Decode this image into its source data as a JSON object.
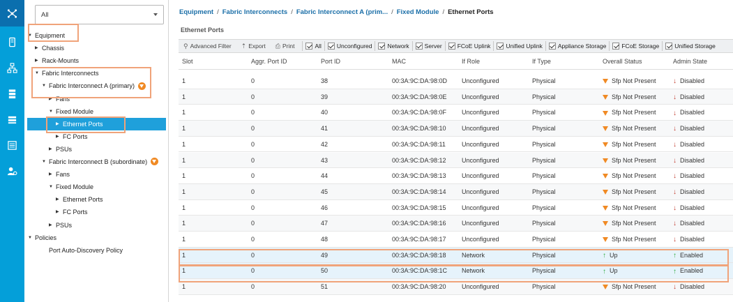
{
  "nav": {
    "filter": {
      "value": "All"
    },
    "items": [
      {
        "label": "Equipment",
        "level": 0,
        "arrow": "▼",
        "selected": false
      },
      {
        "label": "Chassis",
        "level": 1,
        "arrow": "▶",
        "selected": false
      },
      {
        "label": "Rack-Mounts",
        "level": 1,
        "arrow": "▶",
        "selected": false
      },
      {
        "label": "Fabric Interconnects",
        "level": 1,
        "arrow": "▼",
        "selected": false
      },
      {
        "label": "Fabric Interconnect A (primary)",
        "level": 2,
        "arrow": "▼",
        "selected": false,
        "warn": true
      },
      {
        "label": "Fans",
        "level": 3,
        "arrow": "▶",
        "selected": false
      },
      {
        "label": "Fixed Module",
        "level": 3,
        "arrow": "▼",
        "selected": false
      },
      {
        "label": "Ethernet Ports",
        "level": 4,
        "arrow": "▶",
        "selected": true
      },
      {
        "label": "FC Ports",
        "level": 4,
        "arrow": "▶",
        "selected": false
      },
      {
        "label": "PSUs",
        "level": 3,
        "arrow": "▶",
        "selected": false
      },
      {
        "label": "Fabric Interconnect B (subordinate)",
        "level": 2,
        "arrow": "▼",
        "selected": false,
        "warn": true
      },
      {
        "label": "Fans",
        "level": 3,
        "arrow": "▶",
        "selected": false
      },
      {
        "label": "Fixed Module",
        "level": 3,
        "arrow": "▼",
        "selected": false
      },
      {
        "label": "Ethernet Ports",
        "level": 4,
        "arrow": "▶",
        "selected": false
      },
      {
        "label": "FC Ports",
        "level": 4,
        "arrow": "▶",
        "selected": false
      },
      {
        "label": "PSUs",
        "level": 3,
        "arrow": "▶",
        "selected": false
      },
      {
        "label": "Policies",
        "level": 0,
        "arrow": "▼",
        "selected": false
      },
      {
        "label": "Port Auto-Discovery Policy",
        "level": 2,
        "arrow": "",
        "selected": false
      }
    ]
  },
  "breadcrumb": {
    "items": [
      "Equipment",
      "Fabric Interconnects",
      "Fabric Interconnect A (prim...",
      "Fixed Module"
    ],
    "current": "Ethernet Ports",
    "separator": "/"
  },
  "section_title": "Ethernet Ports",
  "toolbar": {
    "advanced_filter": "Advanced Filter",
    "export": "Export",
    "print": "Print",
    "filters": [
      "All",
      "Unconfigured",
      "Network",
      "Server",
      "FCoE Uplink",
      "Unified Uplink",
      "Appliance Storage",
      "FCoE Storage",
      "Unified Storage"
    ]
  },
  "table": {
    "columns": [
      "Slot",
      "Aggr. Port ID",
      "Port ID",
      "MAC",
      "If Role",
      "If Type",
      "Overall Status",
      "Admin State"
    ],
    "rows": [
      {
        "slot": "1",
        "aggr": "0",
        "port": "38",
        "mac": "00:3A:9C:DA:98:0D",
        "role": "Unconfigured",
        "type": "Physical",
        "status": "Sfp Not Present",
        "admin": "Disabled",
        "up": false
      },
      {
        "slot": "1",
        "aggr": "0",
        "port": "39",
        "mac": "00:3A:9C:DA:98:0E",
        "role": "Unconfigured",
        "type": "Physical",
        "status": "Sfp Not Present",
        "admin": "Disabled",
        "up": false
      },
      {
        "slot": "1",
        "aggr": "0",
        "port": "40",
        "mac": "00:3A:9C:DA:98:0F",
        "role": "Unconfigured",
        "type": "Physical",
        "status": "Sfp Not Present",
        "admin": "Disabled",
        "up": false
      },
      {
        "slot": "1",
        "aggr": "0",
        "port": "41",
        "mac": "00:3A:9C:DA:98:10",
        "role": "Unconfigured",
        "type": "Physical",
        "status": "Sfp Not Present",
        "admin": "Disabled",
        "up": false
      },
      {
        "slot": "1",
        "aggr": "0",
        "port": "42",
        "mac": "00:3A:9C:DA:98:11",
        "role": "Unconfigured",
        "type": "Physical",
        "status": "Sfp Not Present",
        "admin": "Disabled",
        "up": false
      },
      {
        "slot": "1",
        "aggr": "0",
        "port": "43",
        "mac": "00:3A:9C:DA:98:12",
        "role": "Unconfigured",
        "type": "Physical",
        "status": "Sfp Not Present",
        "admin": "Disabled",
        "up": false
      },
      {
        "slot": "1",
        "aggr": "0",
        "port": "44",
        "mac": "00:3A:9C:DA:98:13",
        "role": "Unconfigured",
        "type": "Physical",
        "status": "Sfp Not Present",
        "admin": "Disabled",
        "up": false
      },
      {
        "slot": "1",
        "aggr": "0",
        "port": "45",
        "mac": "00:3A:9C:DA:98:14",
        "role": "Unconfigured",
        "type": "Physical",
        "status": "Sfp Not Present",
        "admin": "Disabled",
        "up": false
      },
      {
        "slot": "1",
        "aggr": "0",
        "port": "46",
        "mac": "00:3A:9C:DA:98:15",
        "role": "Unconfigured",
        "type": "Physical",
        "status": "Sfp Not Present",
        "admin": "Disabled",
        "up": false
      },
      {
        "slot": "1",
        "aggr": "0",
        "port": "47",
        "mac": "00:3A:9C:DA:98:16",
        "role": "Unconfigured",
        "type": "Physical",
        "status": "Sfp Not Present",
        "admin": "Disabled",
        "up": false
      },
      {
        "slot": "1",
        "aggr": "0",
        "port": "48",
        "mac": "00:3A:9C:DA:98:17",
        "role": "Unconfigured",
        "type": "Physical",
        "status": "Sfp Not Present",
        "admin": "Disabled",
        "up": false
      },
      {
        "slot": "1",
        "aggr": "0",
        "port": "49",
        "mac": "00:3A:9C:DA:98:18",
        "role": "Network",
        "type": "Physical",
        "status": "Up",
        "admin": "Enabled",
        "up": true
      },
      {
        "slot": "1",
        "aggr": "0",
        "port": "50",
        "mac": "00:3A:9C:DA:98:1C",
        "role": "Network",
        "type": "Physical",
        "status": "Up",
        "admin": "Enabled",
        "up": true
      },
      {
        "slot": "1",
        "aggr": "0",
        "port": "51",
        "mac": "00:3A:9C:DA:98:20",
        "role": "Unconfigured",
        "type": "Physical",
        "status": "Sfp Not Present",
        "admin": "Disabled",
        "up": false
      }
    ]
  },
  "colors": {
    "rail": "#049fd9",
    "selected": "#1fa0db",
    "link": "#1b6fa8",
    "warn": "#f08a24",
    "highlight": "#f0a37a"
  }
}
